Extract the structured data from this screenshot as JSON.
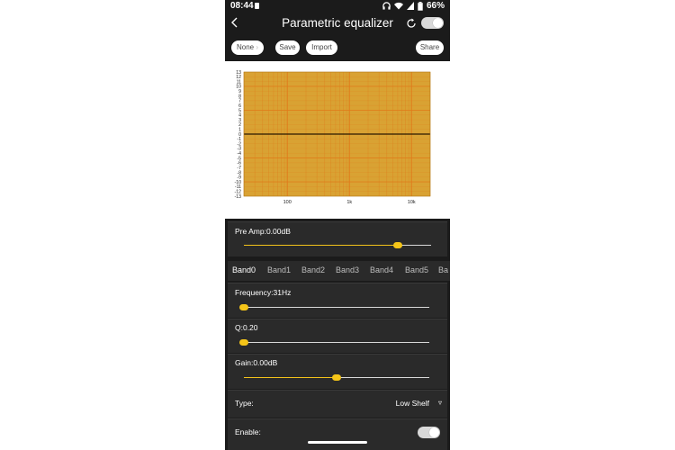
{
  "status_bar": {
    "time": "08:44",
    "battery_percent": "66%",
    "icons": [
      "sd-card-icon",
      "headphones-icon",
      "wifi-icon",
      "signal-icon",
      "battery-icon"
    ]
  },
  "app_bar": {
    "title": "Parametric equalizer",
    "icons": [
      "back-arrow-icon",
      "reset-icon"
    ],
    "enabled": true
  },
  "toolbar": {
    "preset_label": "None",
    "save_label": "Save",
    "import_label": "Import",
    "share_label": "Share"
  },
  "chart_data": {
    "type": "line",
    "title": "",
    "xlabel": "",
    "ylabel": "",
    "x_scale": "log",
    "x_ticks": [
      "100",
      "1k",
      "10k"
    ],
    "y_ticks": [
      "13",
      "12",
      "11",
      "10",
      "9",
      "8",
      "7",
      "6",
      "5",
      "4",
      "3",
      "2",
      "1",
      "0",
      "-1",
      "-2",
      "-3",
      "-4",
      "-5",
      "-6",
      "-7",
      "-8",
      "-9",
      "-10",
      "-11",
      "-12",
      "-13"
    ],
    "ylim": [
      -13,
      13
    ],
    "xlim": [
      20,
      20000
    ],
    "grid": true,
    "plot_background": "#d9a233",
    "grid_color": "#e07a1a",
    "series": [
      {
        "x": [
          20,
          20000
        ],
        "y": [
          0,
          0
        ],
        "color": "#2b1a00"
      }
    ]
  },
  "preamp": {
    "label": "Pre Amp:0.00dB",
    "level": 0.82
  },
  "band_tabs": {
    "items": [
      "Band0",
      "Band1",
      "Band2",
      "Band3",
      "Band4",
      "Band5",
      "Ba"
    ],
    "active_index": 0
  },
  "frequency": {
    "label": "Frequency:31Hz",
    "level": 0.0
  },
  "q": {
    "label": "Q:0.20",
    "level": 0.0
  },
  "gain": {
    "label": "Gain:0.00dB",
    "level": 0.5
  },
  "type": {
    "label": "Type:",
    "value": "Low Shelf",
    "caret": "▿"
  },
  "enable": {
    "label": "Enable:",
    "on": false
  },
  "colors": {
    "accent": "#f5c518",
    "panel": "#2a2a2a",
    "background": "#1b1b1b"
  }
}
